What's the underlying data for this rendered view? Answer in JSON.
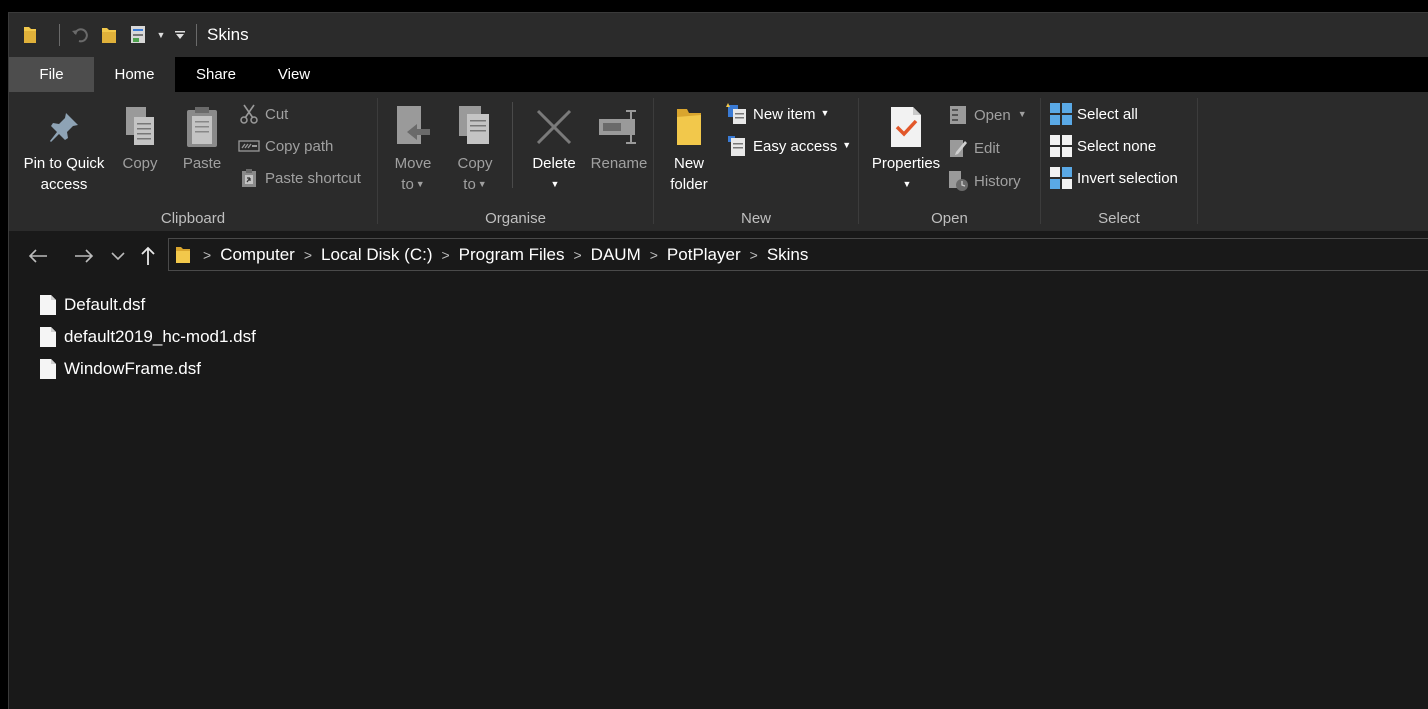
{
  "window": {
    "title": "Skins"
  },
  "tabs": [
    {
      "label": "File"
    },
    {
      "label": "Home"
    },
    {
      "label": "Share"
    },
    {
      "label": "View"
    }
  ],
  "ribbon": {
    "clipboard": {
      "label": "Clipboard",
      "pin_line1": "Pin to Quick",
      "pin_line2": "access",
      "copy": "Copy",
      "paste": "Paste",
      "cut": "Cut",
      "copy_path": "Copy path",
      "paste_shortcut": "Paste shortcut"
    },
    "organise": {
      "label": "Organise",
      "move_line1": "Move",
      "move_line2": "to",
      "copy_line1": "Copy",
      "copy_line2": "to",
      "delete": "Delete",
      "rename": "Rename"
    },
    "new": {
      "label": "New",
      "folder_line1": "New",
      "folder_line2": "folder",
      "new_item": "New item",
      "easy_access": "Easy access"
    },
    "open": {
      "label": "Open",
      "properties": "Properties",
      "open": "Open",
      "edit": "Edit",
      "history": "History"
    },
    "select": {
      "label": "Select",
      "select_all": "Select all",
      "select_none": "Select none",
      "invert": "Invert selection"
    }
  },
  "breadcrumb": [
    "Computer",
    "Local Disk (C:)",
    "Program Files",
    "DAUM",
    "PotPlayer",
    "Skins"
  ],
  "files": [
    {
      "name": "Default.dsf"
    },
    {
      "name": "default2019_hc-mod1.dsf"
    },
    {
      "name": "WindowFrame.dsf"
    }
  ],
  "colors": {
    "accent": "#0078d7",
    "folder": "#f2c84b",
    "check": "#e2572a"
  }
}
